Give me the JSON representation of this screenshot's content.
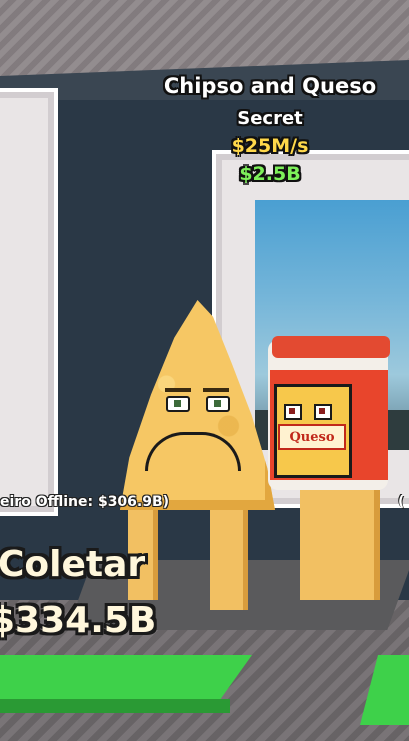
{
  "brainrot": {
    "name": "Chipso and Queso",
    "rarity": "Secret",
    "income_rate": "$25M/s",
    "price": "$2.5B",
    "jar_label": "Queso"
  },
  "collector": {
    "offline_text": "eiro Offline: $306.9B)",
    "offline_text_right": "(",
    "collect_label": "Coletar",
    "collect_amount": "$334.5B"
  },
  "colors": {
    "rate_yellow": "#ffd84a",
    "price_green": "#7df05a",
    "pad_green": "#3ed14a"
  }
}
